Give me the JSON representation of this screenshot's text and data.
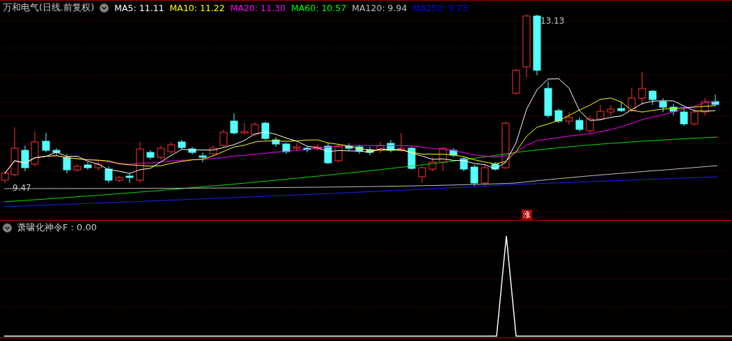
{
  "main_panel": {
    "title": "万和电气(日线.前复权)",
    "moving_averages": [
      {
        "text": "MA5: 11.11",
        "color": "#ffffff"
      },
      {
        "text": "MA10: 11.22",
        "color": "#ffff00"
      },
      {
        "text": "MA20: 11.30",
        "color": "#ff00ff"
      },
      {
        "text": "MA60: 10.57",
        "color": "#00ff00"
      },
      {
        "text": "MA120: 9.94",
        "color": "#c0c0c0"
      },
      {
        "text": "MA250: 9.73",
        "color": "#0000ff"
      }
    ],
    "high_label": "13.13",
    "low_label": "9.47",
    "badge": "涨"
  },
  "indicator_panel": {
    "title": "萧啸化神令F : 0.00"
  }
}
